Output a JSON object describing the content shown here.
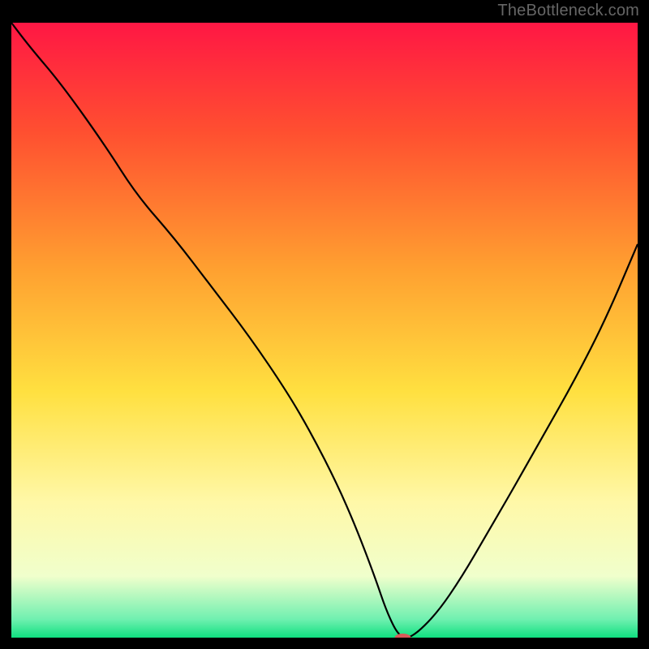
{
  "watermark": "TheBottleneck.com",
  "chart_data": {
    "type": "line",
    "title": "",
    "xlabel": "",
    "ylabel": "",
    "xlim": [
      0,
      100
    ],
    "ylim": [
      0,
      100
    ],
    "background_gradient": {
      "stops": [
        {
          "offset": 0,
          "color": "#ff1744"
        },
        {
          "offset": 18,
          "color": "#ff5030"
        },
        {
          "offset": 40,
          "color": "#ffa030"
        },
        {
          "offset": 60,
          "color": "#ffe040"
        },
        {
          "offset": 78,
          "color": "#fff8a8"
        },
        {
          "offset": 90,
          "color": "#f0ffcc"
        },
        {
          "offset": 97,
          "color": "#70f0b0"
        },
        {
          "offset": 100,
          "color": "#10e080"
        }
      ]
    },
    "series": [
      {
        "name": "bottleneck-curve",
        "color": "#000000",
        "stroke_width": 2.2,
        "x": [
          0,
          3,
          8,
          15,
          20,
          26,
          32,
          38,
          44,
          48,
          52,
          55,
          58,
          60,
          62,
          64,
          68,
          72,
          76,
          80,
          85,
          90,
          95,
          100
        ],
        "y": [
          100,
          96,
          90,
          80,
          72,
          65,
          57,
          49,
          40,
          33,
          25,
          18,
          10,
          4,
          0,
          0,
          4,
          10,
          17,
          24,
          33,
          42,
          52,
          64
        ]
      }
    ],
    "marker": {
      "name": "optimal-point",
      "x": 62.5,
      "y": 0,
      "color": "#d85a5a",
      "rx": 10,
      "ry": 5
    }
  }
}
